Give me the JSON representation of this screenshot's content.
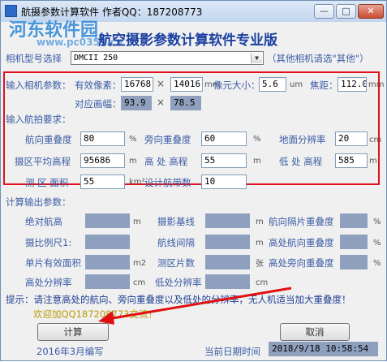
{
  "window": {
    "title": "航摄参数计算软件  作者QQ：187208773",
    "minimize": "—",
    "maximize": "□",
    "close": "✕",
    "heading": "航空摄影参数计算软件专业版"
  },
  "watermark": {
    "line1": "河东软件园",
    "line2": "www.pc0359.cn"
  },
  "camera": {
    "label": "相机型号选择",
    "selected": "DMCII 250",
    "hint": "（其他相机请选\"其他\"）"
  },
  "input_params": {
    "section": "输入相机参数：",
    "effective_pixels_label": "有效像素：",
    "pixel_w": "16768",
    "pixel_h": "14016",
    "pixel_unit": "mm",
    "pixel_size_label": "像元大小：",
    "pixel_size": "5.6",
    "pixel_size_unit": "um",
    "focal_label": "焦距：",
    "focal": "112.0",
    "focal_unit": "mm",
    "diagonal_label": "对应画幅：",
    "frame_w": "93.9",
    "frame_h": "78.5"
  },
  "requirements": {
    "section": "输入航拍要求：",
    "forward_overlap_label": "航向重叠度",
    "forward_overlap": "80",
    "side_overlap_label": "旁向重叠度",
    "side_overlap": "60",
    "percent_unit": "%",
    "gsd_label": "地面分辨率",
    "gsd": "20",
    "gsd_unit": "cm",
    "avg_elev_label": "摄区平均高程",
    "avg_elev": "95686",
    "high_elev_label": "高 处 高程",
    "high_elev": "55",
    "low_elev_label": "低 处 高程",
    "low_elev": "585",
    "m_unit": "m",
    "area_label": "测 区 面积",
    "area": "55",
    "area_unit": "km²",
    "strips_label": "设计航带数",
    "strips": "10"
  },
  "output": {
    "section": "计算输出参数：",
    "rows": [
      [
        "绝对航高",
        "m",
        "摄影基线",
        "m",
        "航向隔片重叠度",
        "%"
      ],
      [
        "摄比例尺1:",
        "",
        "航线间隔",
        "m",
        "高处航向重叠度",
        "%"
      ],
      [
        "单片有效面积",
        "m2",
        "测区片数",
        "张",
        "高处旁向重叠度",
        "%"
      ],
      [
        "高处分辨率",
        "cm",
        "低处分辨率",
        "cm",
        "",
        ""
      ]
    ]
  },
  "hint_text": "提示：请注意高处的航向、旁向重叠度以及低处的分辨率，无人机适当加大重叠度！",
  "welcome_text": "欢迎加QQ187208773交流！",
  "buttons": {
    "calculate": "计算",
    "cancel": "取消"
  },
  "footer": {
    "written": "2016年3月编写",
    "date_label": "当前日期时间",
    "datetime": "2018/9/18  10:58:54"
  }
}
